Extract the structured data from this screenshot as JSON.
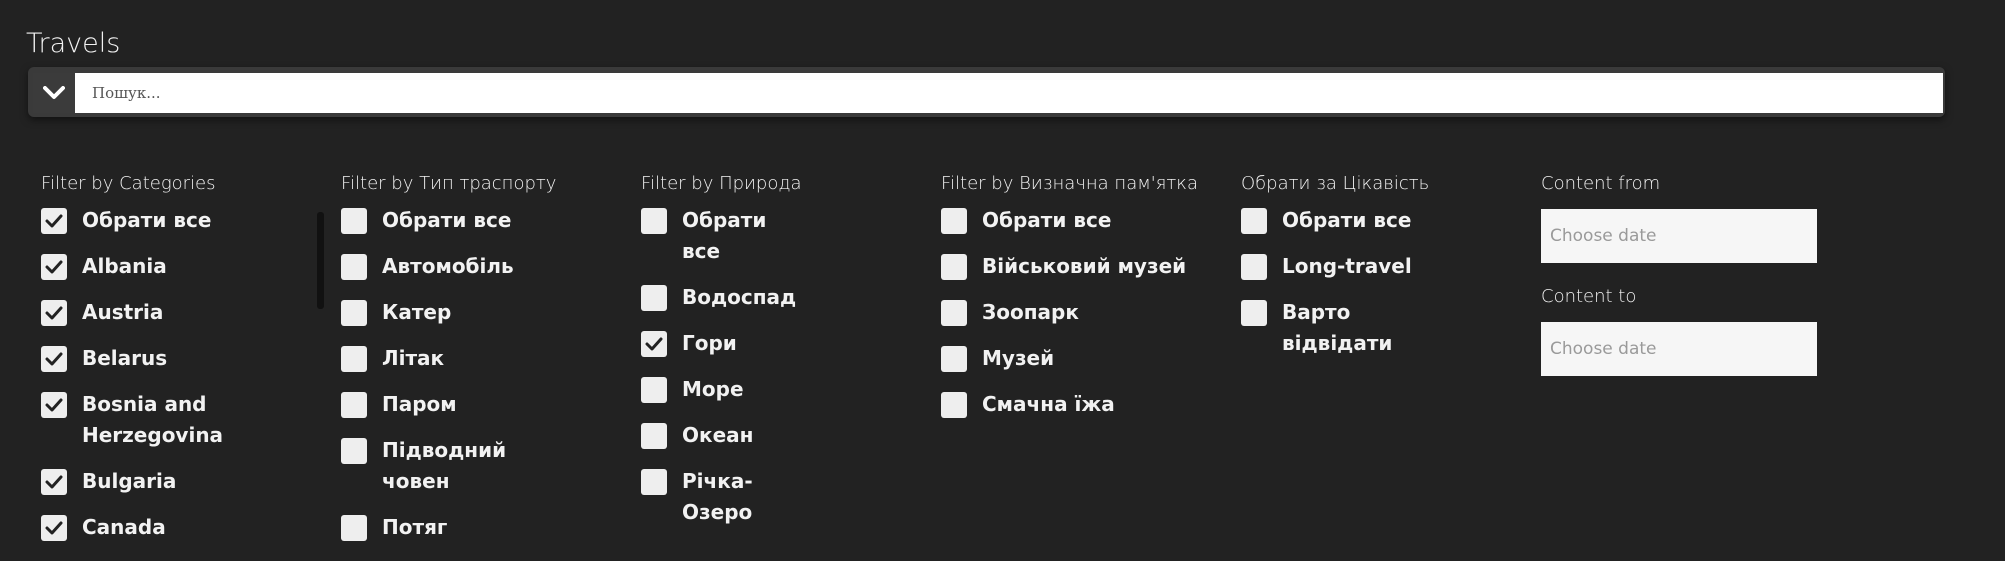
{
  "title": "Travels",
  "search": {
    "placeholder": "Пошук..."
  },
  "filters": [
    {
      "title": "Filter by Categories",
      "items": [
        {
          "label": "Обрати все",
          "checked": true
        },
        {
          "label": "Albania",
          "checked": true
        },
        {
          "label": "Austria",
          "checked": true
        },
        {
          "label": "Belarus",
          "checked": true
        },
        {
          "label": "Bosnia and Herzegovina",
          "checked": true
        },
        {
          "label": "Bulgaria",
          "checked": true
        },
        {
          "label": "Canada",
          "checked": true
        }
      ]
    },
    {
      "title": "Filter by Тип траспорту",
      "items": [
        {
          "label": "Обрати все",
          "checked": false
        },
        {
          "label": "Автомобіль",
          "checked": false
        },
        {
          "label": "Катер",
          "checked": false
        },
        {
          "label": "Літак",
          "checked": false
        },
        {
          "label": "Паром",
          "checked": false
        },
        {
          "label": "Підводний човен",
          "checked": false
        },
        {
          "label": "Потяг",
          "checked": false
        }
      ]
    },
    {
      "title": "Filter by Природа",
      "items": [
        {
          "label": "Обрати все",
          "checked": false
        },
        {
          "label": "Водоспад",
          "checked": false
        },
        {
          "label": "Гори",
          "checked": true
        },
        {
          "label": "Море",
          "checked": false
        },
        {
          "label": "Океан",
          "checked": false
        },
        {
          "label": "Річка-Озеро",
          "checked": false
        }
      ]
    },
    {
      "title": "Filter by Визначна пам'ятка",
      "items": [
        {
          "label": "Обрати все",
          "checked": false
        },
        {
          "label": "Військовий музей",
          "checked": false
        },
        {
          "label": "Зоопарк",
          "checked": false
        },
        {
          "label": "Музей",
          "checked": false
        },
        {
          "label": "Смачна їжа",
          "checked": false
        }
      ]
    },
    {
      "title": "Обрати за Цікавість",
      "items": [
        {
          "label": "Обрати все",
          "checked": false
        },
        {
          "label": "Long-travel",
          "checked": false
        },
        {
          "label": "Варто відвідати",
          "checked": false
        }
      ]
    }
  ],
  "dates": {
    "from_label": "Content from",
    "from_placeholder": "Choose date",
    "to_label": "Content to",
    "to_placeholder": "Choose date"
  }
}
